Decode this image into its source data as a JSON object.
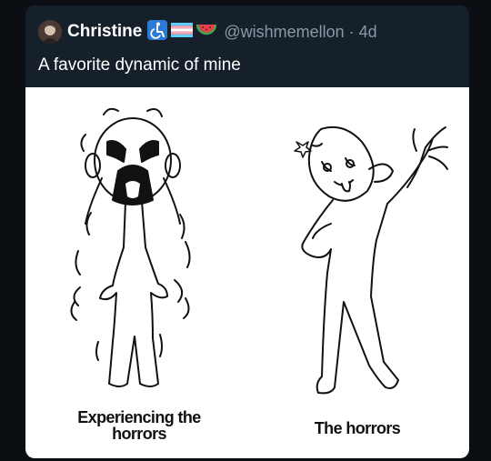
{
  "post": {
    "author_name": "Christine",
    "handle_time": "@wishmemellon · 4d",
    "text": "A favorite dynamic of mine",
    "badges": [
      "wheelchair-icon",
      "trans-flag-icon",
      "watermelon-icon"
    ]
  },
  "image": {
    "caption_left": "Experiencing the horrors",
    "caption_right": "The horrors"
  }
}
